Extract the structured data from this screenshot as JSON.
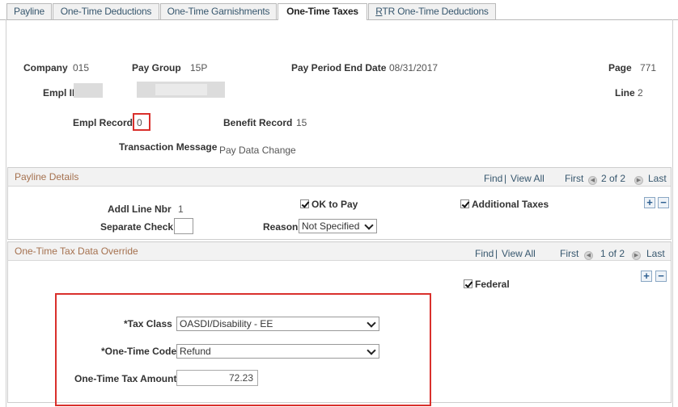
{
  "tabs": [
    {
      "label": "Payline"
    },
    {
      "label": "One-Time Deductions"
    },
    {
      "label": "One-Time Garnishments"
    },
    {
      "label": "One-Time Taxes"
    },
    {
      "label_u": "R",
      "label_rest": "TR One-Time Deductions"
    }
  ],
  "header": {
    "company_label": "Company",
    "company_value": "015",
    "pay_group_label": "Pay Group",
    "pay_group_value": "15P",
    "period_label": "Pay Period End Date",
    "period_value": "08/31/2017",
    "page_label": "Page",
    "page_value": "771",
    "empl_id_label": "Empl ID",
    "line_label": "Line",
    "line_value": "2",
    "empl_record_label": "Empl Record",
    "empl_record_value": "0",
    "benefit_record_label": "Benefit Record",
    "benefit_record_value": "15",
    "transaction_label": "Transaction Message",
    "transaction_value": "Pay Data Change"
  },
  "payline": {
    "title": "Payline Details",
    "find": "Find",
    "sep": "|",
    "view_all": "View All",
    "first": "First",
    "count": "2 of 2",
    "last": "Last",
    "addl_line_label": "Addl Line Nbr",
    "addl_line_value": "1",
    "ok_to_pay_label": "OK to Pay",
    "additional_taxes_label": "Additional Taxes",
    "separate_check_label": "Separate Check",
    "reason_label": "Reason",
    "reason_value": "Not Specified"
  },
  "tax_override": {
    "title": "One-Time Tax Data Override",
    "find": "Find",
    "sep": "|",
    "view_all": "View All",
    "first": "First",
    "count": "1 of 2",
    "last": "Last",
    "federal_label": "Federal",
    "tax_class_label": "*Tax Class",
    "tax_class_value": "OASDI/Disability - EE",
    "one_time_code_label": "*One-Time Code",
    "one_time_code_value": "Refund",
    "amount_label": "One-Time Tax Amount",
    "amount_value": "72.23"
  },
  "colors": {
    "highlight": "#d9302c",
    "section_title": "#a5714f",
    "link": "#37576e"
  }
}
